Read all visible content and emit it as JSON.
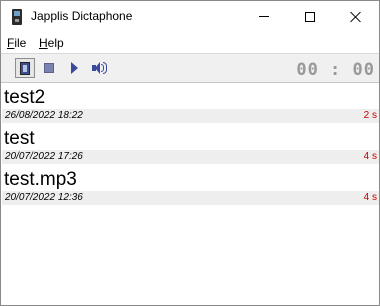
{
  "window": {
    "title": "Japplis Dictaphone",
    "icon": "dictaphone-app-icon"
  },
  "window_controls": {
    "minimize_icon": "minimize-icon",
    "maximize_icon": "maximize-icon",
    "close_icon": "close-icon"
  },
  "menu": {
    "file_mnemonic": "F",
    "file_rest": "ile",
    "help_mnemonic": "H",
    "help_rest": "elp"
  },
  "toolbar": {
    "buttons": [
      {
        "icon": "record-icon",
        "pressed": true
      },
      {
        "icon": "stop-icon",
        "pressed": false
      },
      {
        "icon": "play-icon",
        "pressed": false
      },
      {
        "icon": "volume-icon",
        "pressed": false
      }
    ],
    "timer": "00:00",
    "timer_color": "#999999"
  },
  "recordings": [
    {
      "name": "test2",
      "date": "26/08/2022 18:22",
      "duration": "2 s"
    },
    {
      "name": "test",
      "date": "20/07/2022 17:26",
      "duration": "4 s"
    },
    {
      "name": "test.mp3",
      "date": "20/07/2022 12:36",
      "duration": "4 s"
    }
  ],
  "colors": {
    "duration": "#cc0000",
    "meta_background": "#eeeeee",
    "toolbar_background": "#f0f0f0"
  }
}
